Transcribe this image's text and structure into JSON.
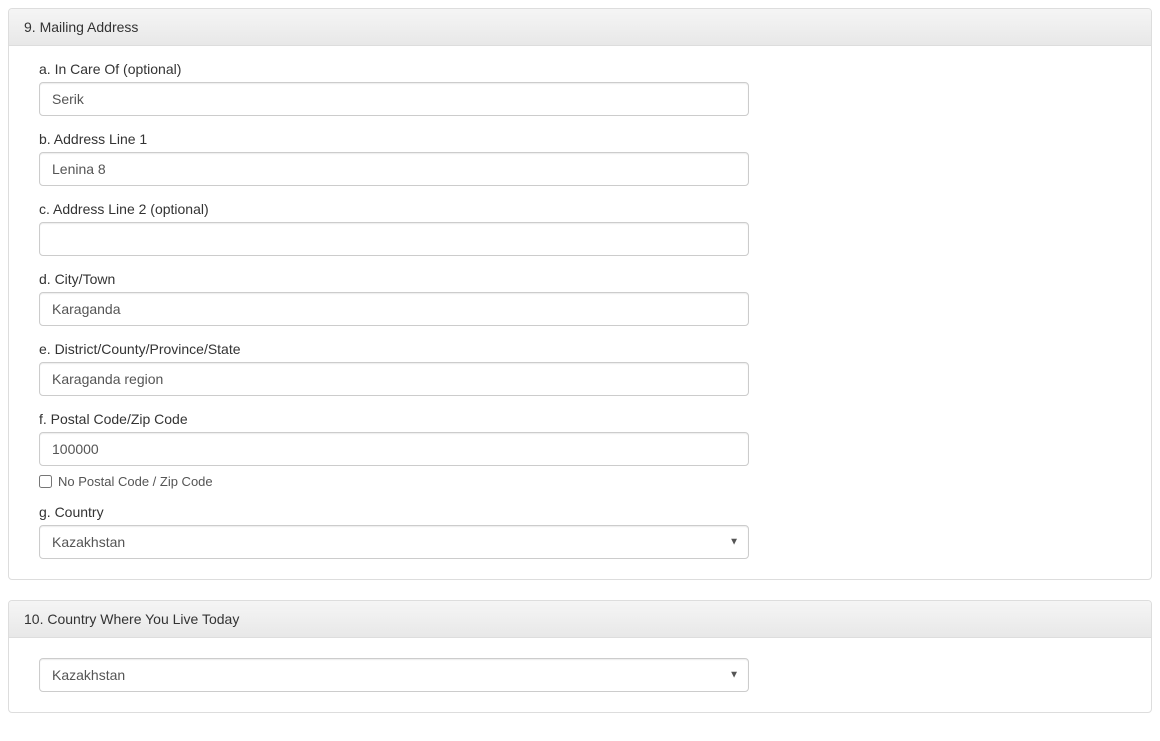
{
  "section9": {
    "heading": "9. Mailing Address",
    "fields": {
      "inCareOf": {
        "label": "a. In Care Of (optional)",
        "value": "Serik"
      },
      "addressLine1": {
        "label": "b. Address Line 1",
        "value": "Lenina 8"
      },
      "addressLine2": {
        "label": "c. Address Line 2 (optional)",
        "value": ""
      },
      "cityTown": {
        "label": "d. City/Town",
        "value": "Karaganda"
      },
      "district": {
        "label": "e. District/County/Province/State",
        "value": "Karaganda region"
      },
      "postalCode": {
        "label": "f. Postal Code/Zip Code",
        "value": "100000",
        "noPostalLabel": "No Postal Code / Zip Code",
        "noPostalChecked": false
      },
      "country": {
        "label": "g. Country",
        "value": "Kazakhstan"
      }
    }
  },
  "section10": {
    "heading": "10. Country Where You Live Today",
    "country": {
      "value": "Kazakhstan"
    }
  }
}
